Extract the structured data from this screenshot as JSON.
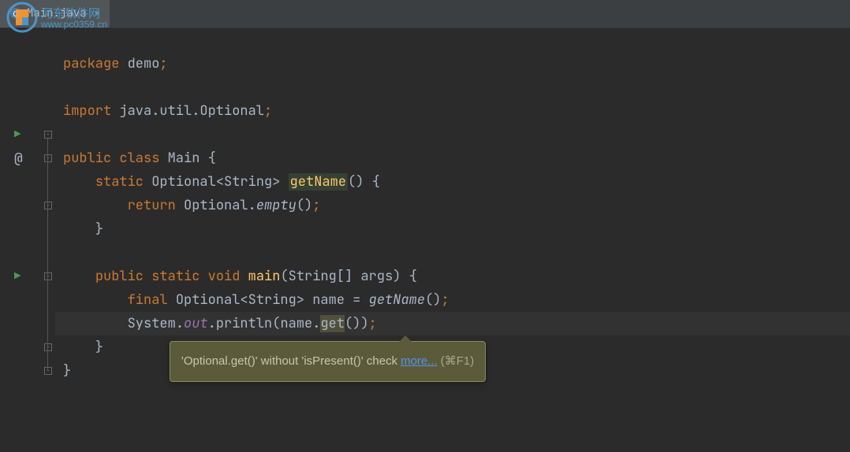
{
  "watermark": {
    "text": "河东软件网",
    "url": "www.pc0359.cn"
  },
  "tab": {
    "filename": "Main.java",
    "close_label": "×"
  },
  "code": {
    "line1_package": "package",
    "line1_name": "demo",
    "line3_import": "import",
    "line3_path": "java.util.Optional",
    "line5_public": "public",
    "line5_class": "class",
    "line5_name": "Main",
    "line6_static": "static",
    "line6_type": "Optional",
    "line6_generic": "String",
    "line6_method": "getName",
    "line7_return": "return",
    "line7_class": "Optional",
    "line7_call": "empty",
    "line10_public": "public",
    "line10_static": "static",
    "line10_void": "void",
    "line10_method": "main",
    "line10_argtype": "String",
    "line10_argname": "args",
    "line11_final": "final",
    "line11_type": "Optional",
    "line11_generic": "String",
    "line11_var": "name",
    "line11_call": "getName",
    "line12_class": "System",
    "line12_field": "out",
    "line12_method": "println",
    "line12_var": "name",
    "line12_call": "get"
  },
  "tooltip": {
    "message": "'Optional.get()' without 'isPresent()' check ",
    "link": "more...",
    "shortcut": " (⌘F1)"
  },
  "gutter": {
    "run1": "▶",
    "run2": "▶",
    "context": "@"
  }
}
